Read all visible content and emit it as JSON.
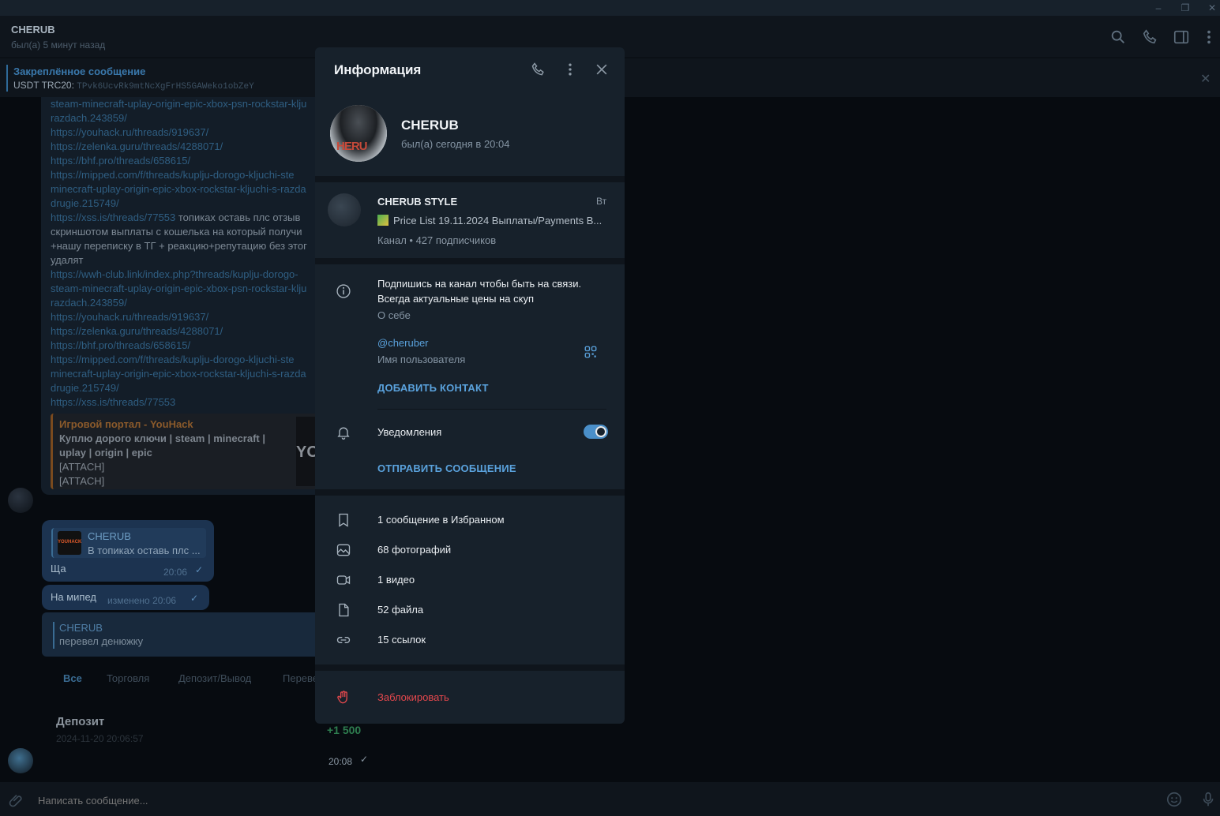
{
  "window": {
    "minimize": "–",
    "restore": "❐",
    "close": "✕"
  },
  "header": {
    "title": "CHERUB",
    "subtitle": "был(а) 5 минут назад"
  },
  "pinned": {
    "title": "Закреплённое сообщение",
    "label": "USDT TRC20:",
    "address": "TPvk6UcvRk9mtNcXgFrHS5GAWeko1obZeY"
  },
  "chat": {
    "lines": [
      "steam-minecraft-uplay-origin-epic-xbox-psn-rockstar-klju",
      "razdach.243859/",
      "https://youhack.ru/threads/919637/",
      "https://zelenka.guru/threads/4288071/",
      "https://bhf.pro/threads/658615/",
      "https://mipped.com/f/threads/kuplju-dorogo-kljuchi-ste",
      "minecraft-uplay-origin-epic-xbox-rockstar-kljuchi-s-razda",
      "drugie.215749/",
      "https://xss.is/threads/77553",
      "скриншотом выплаты с кошелька на который получи",
      "+нашу переписку в ТГ + реакцию+репутацию без этог",
      "удалят",
      "https://wwh-club.link/index.php?threads/kuplju-dorogo-",
      "steam-minecraft-uplay-origin-epic-xbox-psn-rockstar-klju",
      "razdach.243859/",
      "https://youhack.ru/threads/919637/",
      "https://zelenka.guru/threads/4288071/",
      "https://bhf.pro/threads/658615/",
      "https://mipped.com/f/threads/kuplju-dorogo-kljuchi-ste",
      "minecraft-uplay-origin-epic-xbox-rockstar-kljuchi-s-razda",
      "drugie.215749/",
      "https://xss.is/threads/77553"
    ],
    "xss_tail": " топиках оставь плс отзыв",
    "preview": {
      "title": "Игровой портал - YouHack",
      "line1": "Куплю дорого ключи | steam | minecraft |",
      "line2": "uplay | origin | epic",
      "line3": "[ATTACH]",
      "line4": "[ATTACH]",
      "logo": "YO"
    },
    "reply1": {
      "author": "CHERUB",
      "quote": "В топиках оставь плс ...",
      "text": "Ща",
      "time": "20:06",
      "thumb": "YOUHACK"
    },
    "msg2": {
      "text": "На мипед",
      "meta": "изменено 20:06"
    },
    "reply2": {
      "author": "CHERUB",
      "text": "перевел денюжку"
    },
    "tabs": [
      "Все",
      "Торговля",
      "Депозит/Вывод",
      "Переве"
    ],
    "deposit": {
      "title": "Депозит",
      "date": "2024-11-20 20:06:57",
      "amount": "+1 500",
      "time": "20:08"
    }
  },
  "composer": {
    "placeholder": "Написать сообщение..."
  },
  "modal": {
    "title": "Информация",
    "profile": {
      "name": "CHERUB",
      "status": "был(а) сегодня в 20:04",
      "avatar_text": "HERU"
    },
    "channel": {
      "name": "CHERUB STYLE",
      "time": "Вт",
      "message": "Price List 19.11.2024  Выплаты/Payments B...",
      "meta": "Канал • 427 подписчиков"
    },
    "bio": {
      "line1": "Подпишись на канал чтобы быть на связи.",
      "line2": "Всегда актуальные цены на скуп",
      "label": "О себе"
    },
    "username": {
      "value": "@cheruber",
      "label": "Имя пользователя"
    },
    "add_contact": "ДОБАВИТЬ КОНТАКТ",
    "notifications": {
      "label": "Уведомления",
      "enabled": true
    },
    "send_message": "ОТПРАВИТЬ СООБЩЕНИЕ",
    "media": [
      {
        "icon": "bookmark-icon",
        "label": "1 сообщение в Избранном"
      },
      {
        "icon": "photo-icon",
        "label": "68 фотографий"
      },
      {
        "icon": "video-icon",
        "label": "1 видео"
      },
      {
        "icon": "file-icon",
        "label": "52 файла"
      },
      {
        "icon": "link-icon",
        "label": "15 ссылок"
      }
    ],
    "block": "Заблокировать"
  },
  "colors": {
    "accent": "#5aa2dd",
    "danger": "#e5484d",
    "toggle": "#4a8fc9",
    "deposit_amount": "#2e7d4f"
  }
}
